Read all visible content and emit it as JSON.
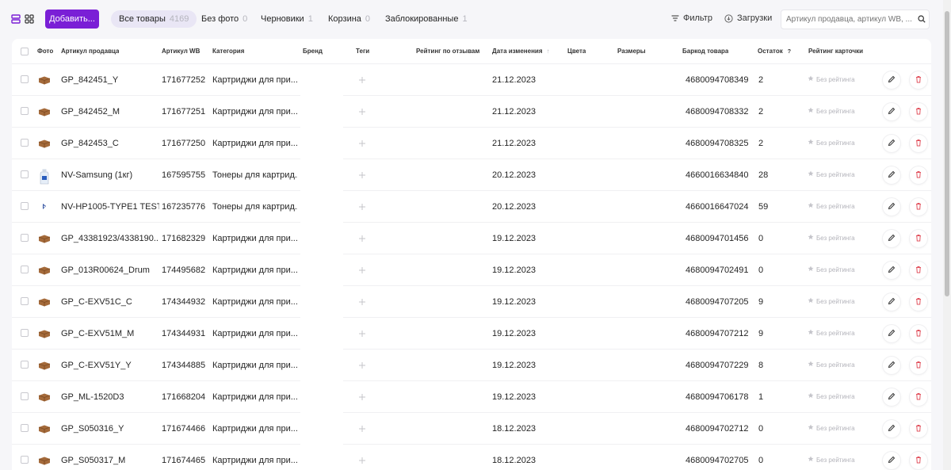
{
  "toolbar": {
    "add_button": "Добавить...",
    "tabs": [
      {
        "label": "Все товары",
        "count": "4169"
      },
      {
        "label": "Без фото",
        "count": "0"
      },
      {
        "label": "Черновики",
        "count": "1"
      },
      {
        "label": "Корзина",
        "count": "0"
      },
      {
        "label": "Заблокированные",
        "count": "1"
      }
    ],
    "filter_label": "Фильтр",
    "downloads_label": "Загрузки",
    "search_placeholder": "Артикул продавца, артикул WB, ...",
    "icons": {
      "list_view": "list-view-icon",
      "grid_view": "grid-view-icon",
      "filter": "filter-icon",
      "downloads": "download-icon",
      "search": "search-icon"
    }
  },
  "table": {
    "headers": {
      "photo": "Фото",
      "vendor_code": "Артикул продавца",
      "wb_code": "Артикул WB",
      "category": "Категория",
      "brand": "Бренд",
      "tags": "Теги",
      "review_rating": "Рейтинг по отзывам",
      "date_changed": "Дата изменения",
      "colors": "Цвета",
      "sizes": "Размеры",
      "barcode": "Баркод товара",
      "stock": "Остаток",
      "stock_hint": "?",
      "card_rating": "Рейтинг карточки"
    },
    "sorted_column": "date_changed",
    "rows": [
      {
        "photo": "cartridge-box",
        "vendor_code": "GP_842451_Y",
        "wb_code": "171677252",
        "category": "Картриджи для при...",
        "date": "21.12.2023",
        "barcode": "4680094708349",
        "stock": "2",
        "rating": "Без рейтинга"
      },
      {
        "photo": "cartridge-box",
        "vendor_code": "GP_842452_M",
        "wb_code": "171677251",
        "category": "Картриджи для при...",
        "date": "21.12.2023",
        "barcode": "4680094708332",
        "stock": "2",
        "rating": "Без рейтинга"
      },
      {
        "photo": "cartridge-box",
        "vendor_code": "GP_842453_C",
        "wb_code": "171677250",
        "category": "Картриджи для при...",
        "date": "21.12.2023",
        "barcode": "4680094708325",
        "stock": "2",
        "rating": "Без рейтинга"
      },
      {
        "photo": "toner-bottle",
        "vendor_code": "NV-Samsung (1кг)",
        "wb_code": "167595755",
        "category": "Тонеры для картрид...",
        "date": "20.12.2023",
        "barcode": "4660016634840",
        "stock": "28",
        "rating": "Без рейтинга"
      },
      {
        "photo": "toner-pack",
        "vendor_code": "NV-HP1005-TYPE1 TEST",
        "wb_code": "167235776",
        "category": "Тонеры для картрид...",
        "date": "20.12.2023",
        "barcode": "4660016647024",
        "stock": "59",
        "rating": "Без рейтинга"
      },
      {
        "photo": "cartridge-box",
        "vendor_code": "GP_43381923/4338190...",
        "wb_code": "171682329",
        "category": "Картриджи для при...",
        "date": "19.12.2023",
        "barcode": "4680094701456",
        "stock": "0",
        "rating": "Без рейтинга"
      },
      {
        "photo": "cartridge-box",
        "vendor_code": "GP_013R00624_Drum",
        "wb_code": "174495682",
        "category": "Картриджи для при...",
        "date": "19.12.2023",
        "barcode": "4680094702491",
        "stock": "0",
        "rating": "Без рейтинга"
      },
      {
        "photo": "cartridge-box",
        "vendor_code": "GP_C-EXV51C_C",
        "wb_code": "174344932",
        "category": "Картриджи для при...",
        "date": "19.12.2023",
        "barcode": "4680094707205",
        "stock": "9",
        "rating": "Без рейтинга"
      },
      {
        "photo": "cartridge-box",
        "vendor_code": "GP_C-EXV51M_M",
        "wb_code": "174344931",
        "category": "Картриджи для при...",
        "date": "19.12.2023",
        "barcode": "4680094707212",
        "stock": "9",
        "rating": "Без рейтинга"
      },
      {
        "photo": "cartridge-box",
        "vendor_code": "GP_C-EXV51Y_Y",
        "wb_code": "174344885",
        "category": "Картриджи для при...",
        "date": "19.12.2023",
        "barcode": "4680094707229",
        "stock": "8",
        "rating": "Без рейтинга"
      },
      {
        "photo": "cartridge-box",
        "vendor_code": "GP_ML-1520D3",
        "wb_code": "171668204",
        "category": "Картриджи для при...",
        "date": "19.12.2023",
        "barcode": "4680094706178",
        "stock": "1",
        "rating": "Без рейтинга"
      },
      {
        "photo": "cartridge-box",
        "vendor_code": "GP_S050316_Y",
        "wb_code": "171674466",
        "category": "Картриджи для при...",
        "date": "18.12.2023",
        "barcode": "4680094702712",
        "stock": "0",
        "rating": "Без рейтинга"
      },
      {
        "photo": "cartridge-box",
        "vendor_code": "GP_S050317_M",
        "wb_code": "171674465",
        "category": "Картриджи для при...",
        "date": "18.12.2023",
        "barcode": "4680094702705",
        "stock": "0",
        "rating": "Без рейтинга"
      }
    ]
  },
  "colors": {
    "accent": "#7a1fd6",
    "active_tab_bg": "#e9e6f5",
    "delete_icon": "#e2525e",
    "muted": "#b5b5bd"
  }
}
